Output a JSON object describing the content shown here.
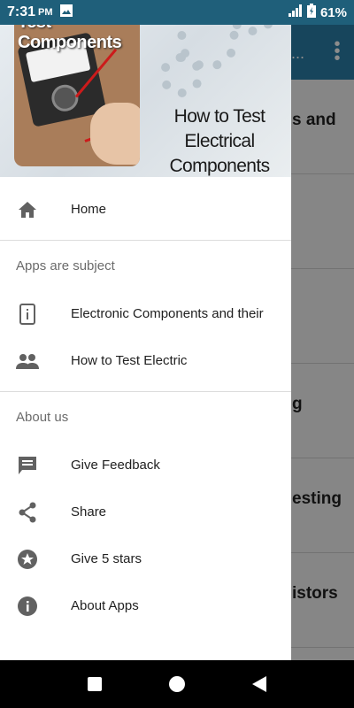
{
  "status_bar": {
    "time": "7:31",
    "ampm": "PM",
    "battery": "61%"
  },
  "header": {
    "image_title": "Test Components",
    "image_caption_line1": "How to Test",
    "image_caption_line2": "Electrical Components"
  },
  "menu": {
    "home": {
      "label": "Home",
      "icon": "home-icon"
    },
    "section_apps": "Apps are subject",
    "apps": [
      {
        "label": "Electronic Components and their",
        "icon": "phone-icon"
      },
      {
        "label": "How to Test Electric",
        "icon": "people-icon"
      }
    ],
    "section_about": "About us",
    "about": [
      {
        "label": "Give Feedback",
        "icon": "feedback-icon"
      },
      {
        "label": "Share",
        "icon": "share-icon"
      },
      {
        "label": "Give 5 stars",
        "icon": "star-icon"
      },
      {
        "label": "About Apps",
        "icon": "info-icon"
      }
    ]
  },
  "background_list": [
    "s and",
    "",
    "",
    "g",
    "esting",
    "istors"
  ],
  "colors": {
    "accent": "#2a7fa8",
    "status_bar": "#1f5f7a",
    "icon": "#616161"
  }
}
